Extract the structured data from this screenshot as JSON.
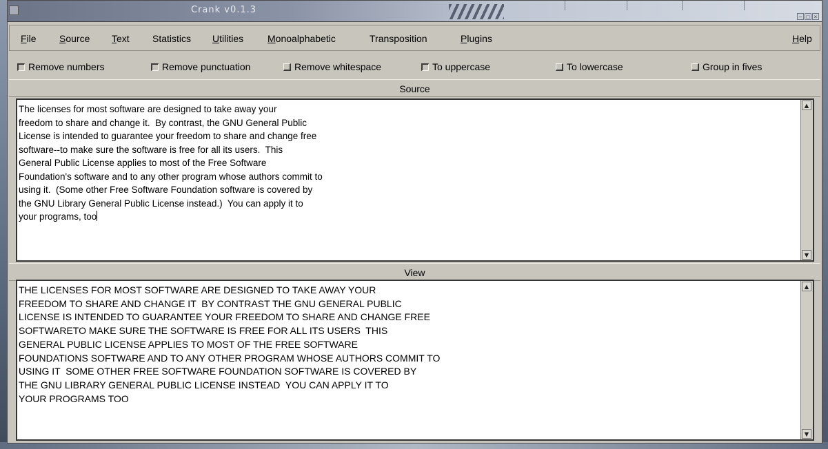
{
  "window": {
    "title": "Crank v0.1.3",
    "controls": [
      "–",
      "□",
      "×"
    ]
  },
  "menu": {
    "items": [
      {
        "mnemonic": "F",
        "rest": "ile"
      },
      {
        "mnemonic": "S",
        "rest": "ource"
      },
      {
        "mnemonic": "T",
        "rest": "ext"
      },
      {
        "mnemonic": "",
        "rest": "Statistics"
      },
      {
        "mnemonic": "U",
        "rest": "tilities"
      },
      {
        "mnemonic": "M",
        "rest": "onoalphabetic"
      },
      {
        "mnemonic": "",
        "rest": "Transposition"
      },
      {
        "mnemonic": "P",
        "rest": "lugins"
      }
    ],
    "help": {
      "mnemonic": "H",
      "rest": "elp"
    }
  },
  "options": [
    {
      "label": "Remove numbers",
      "checked": true
    },
    {
      "label": "Remove punctuation",
      "checked": true
    },
    {
      "label": "Remove whitespace",
      "checked": false
    },
    {
      "label": "To uppercase",
      "checked": true
    },
    {
      "label": "To lowercase",
      "checked": false
    },
    {
      "label": "Group in fives",
      "checked": false
    }
  ],
  "source": {
    "header": "Source",
    "text": "The licenses for most software are designed to take away your\nfreedom to share and change it.  By contrast, the GNU General Public\nLicense is intended to guarantee your freedom to share and change free\nsoftware--to make sure the software is free for all its users.  This\nGeneral Public License applies to most of the Free Software\nFoundation's software and to any other program whose authors commit to\nusing it.  (Some other Free Software Foundation software is covered by\nthe GNU Library General Public License instead.)  You can apply it to\nyour programs, too"
  },
  "view": {
    "header": "View",
    "text": "THE LICENSES FOR MOST SOFTWARE ARE DESIGNED TO TAKE AWAY YOUR\nFREEDOM TO SHARE AND CHANGE IT  BY CONTRAST THE GNU GENERAL PUBLIC\nLICENSE IS INTENDED TO GUARANTEE YOUR FREEDOM TO SHARE AND CHANGE FREE\nSOFTWARETO MAKE SURE THE SOFTWARE IS FREE FOR ALL ITS USERS  THIS\nGENERAL PUBLIC LICENSE APPLIES TO MOST OF THE FREE SOFTWARE\nFOUNDATIONS SOFTWARE AND TO ANY OTHER PROGRAM WHOSE AUTHORS COMMIT TO\nUSING IT  SOME OTHER FREE SOFTWARE FOUNDATION SOFTWARE IS COVERED BY\nTHE GNU LIBRARY GENERAL PUBLIC LICENSE INSTEAD  YOU CAN APPLY IT TO\nYOUR PROGRAMS TOO"
  },
  "scroll_arrows": {
    "up": "▲",
    "down": "▼"
  }
}
